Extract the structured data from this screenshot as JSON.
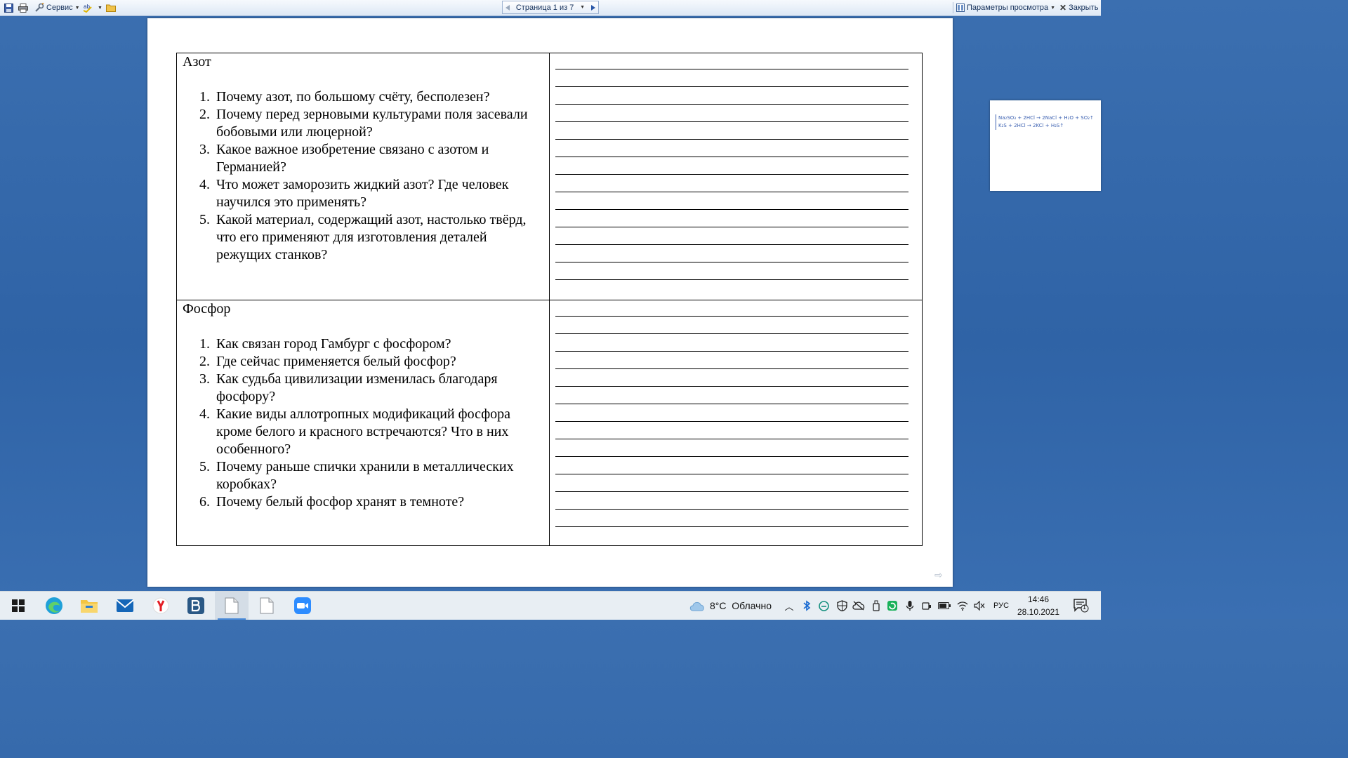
{
  "toolbar": {
    "service_label": "Сервис",
    "page_indicator": "Страница 1 из 7",
    "view_options_label": "Параметры просмотра",
    "close_label": "Закрыть"
  },
  "document": {
    "sections": [
      {
        "title": "Азот",
        "questions": [
          {
            "num": "1.",
            "text": "Почему азот, по большому счёту, бесполезен?"
          },
          {
            "num": "2.",
            "text": "Почему перед зерновыми культурами поля засевали бобовыми или люцерной?"
          },
          {
            "num": "3.",
            "text": "Какое важное изобретение связано с азотом и Германией?"
          },
          {
            "num": "4.",
            "text": "Что может заморозить жидкий азот? Где человек научился это применять?"
          },
          {
            "num": "5.",
            "text": "Какой материал, содержащий азот, настолько твёрд, что его применяют для изготовления деталей режущих станков?"
          }
        ]
      },
      {
        "title": "Фосфор",
        "questions": [
          {
            "num": "1.",
            "text": "Как связан город Гамбург с фосфором?"
          },
          {
            "num": "2.",
            "text": "Где сейчас применяется белый фосфор?"
          },
          {
            "num": "3.",
            "text": "Как судьба цивилизации изменилась благодаря фосфору?"
          },
          {
            "num": "4.",
            "text": "Какие виды аллотропных модификаций фосфора кроме белого и красного встречаются? Что в них особенного?"
          },
          {
            "num": "5.",
            "text": "Почему раньше спички хранили в металлических коробках?"
          },
          {
            "num": "6.",
            "text": "Почему белый фосфор хранят в темноте?"
          }
        ]
      }
    ]
  },
  "thumbnail": {
    "line1": "Na₂SO₃ + 2HCl → 2NaCl + H₂O + SO₂↑",
    "line2": "K₂S + 2HCl → 2KCl + H₂S↑"
  },
  "taskbar": {
    "weather": "8°C  Облачно",
    "language": "РУС",
    "time": "14:46",
    "date": "28.10.2021",
    "notification_count": "1"
  },
  "colors": {
    "desktop": "#2f63a6",
    "toolbar": "#dde8f5",
    "taskbar": "#e8eef3",
    "accent": "#4a8ad8"
  }
}
